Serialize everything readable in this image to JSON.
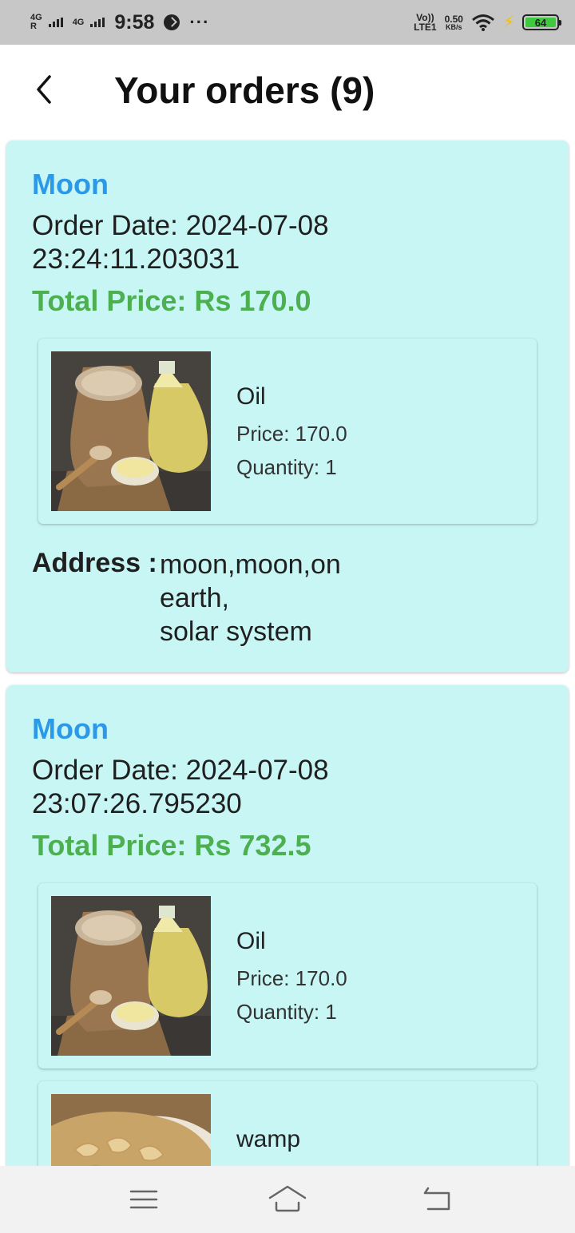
{
  "status_bar": {
    "network_1": "4G",
    "network_1_sub": "R",
    "network_2": "4G",
    "time": "9:58",
    "more": "···",
    "volte_top": "Vo))",
    "volte_bottom": "LTE1",
    "speed_value": "0.50",
    "speed_unit": "KB/s",
    "battery": "64"
  },
  "header": {
    "title": "Your orders (9)",
    "back_icon": "chevron-left-icon"
  },
  "orders": [
    {
      "seller": "Moon",
      "order_date_label": "Order Date: 2024-07-08",
      "order_time": "23:24:11.203031",
      "total_price": "Total Price: Rs 170.0",
      "items": [
        {
          "name": "Oil",
          "price": "Price: 170.0",
          "quantity": "Quantity: 1",
          "image": "oil-product-image"
        }
      ],
      "address_label": "Address :",
      "address_lines": [
        "moon,moon,on",
        "earth,",
        "solar system"
      ]
    },
    {
      "seller": "Moon",
      "order_date_label": "Order Date: 2024-07-08",
      "order_time": "23:07:26.795230",
      "total_price": "Total Price: Rs 732.5",
      "items": [
        {
          "name": "Oil",
          "price": "Price: 170.0",
          "quantity": "Quantity: 1",
          "image": "oil-product-image"
        },
        {
          "name": "wamp",
          "image": "cashew-product-image"
        }
      ]
    }
  ],
  "nav_bar": {
    "menu_icon": "menu-icon",
    "home_icon": "home-icon",
    "back_icon": "back-arrow-icon"
  },
  "colors": {
    "card_bg": "#c7f6f5",
    "seller": "#2c99e8",
    "total_price": "#4caf50",
    "status_bar": "#c7c7c7"
  }
}
